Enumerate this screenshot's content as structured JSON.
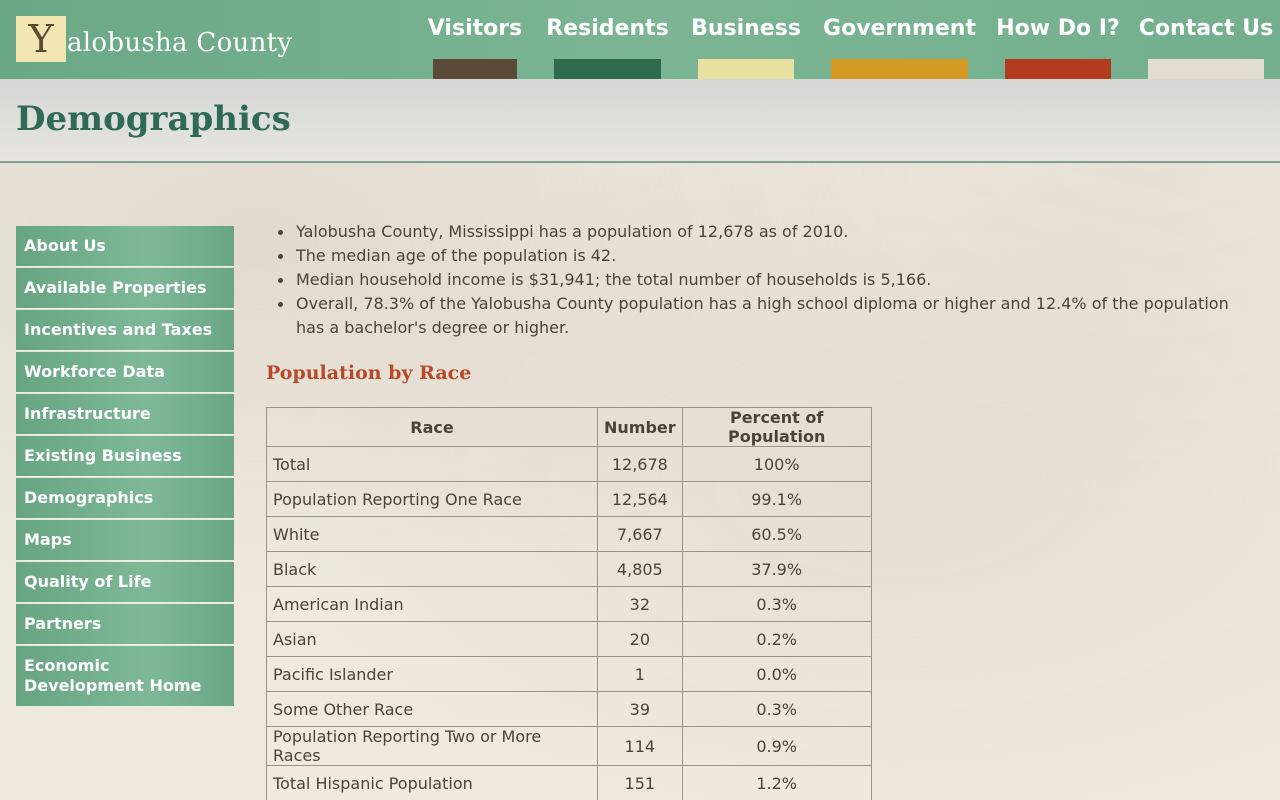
{
  "header": {
    "logo_letter": "Y",
    "logo_text": "alobusha County",
    "nav": [
      {
        "label": "Visitors",
        "color": "#5c4a38"
      },
      {
        "label": "Residents",
        "color": "#2e6a4e"
      },
      {
        "label": "Business",
        "color": "#e8e1a2"
      },
      {
        "label": "Government",
        "color": "#d49a24"
      },
      {
        "label": "How Do I?",
        "color": "#b33c1e"
      },
      {
        "label": "Contact Us",
        "color": "#e2dcd2"
      }
    ]
  },
  "page_title": "Demographics",
  "sidebar": {
    "items": [
      {
        "label": "About Us"
      },
      {
        "label": "Available Properties"
      },
      {
        "label": "Incentives and Taxes"
      },
      {
        "label": "Workforce Data"
      },
      {
        "label": "Infrastructure"
      },
      {
        "label": "Existing Business"
      },
      {
        "label": "Demographics"
      },
      {
        "label": "Maps"
      },
      {
        "label": "Quality of Life"
      },
      {
        "label": "Partners"
      },
      {
        "label": "Economic Development Home"
      }
    ]
  },
  "main": {
    "bullets": [
      "Yalobusha County, Mississippi has a population of 12,678 as of 2010.",
      "The median age of the population is 42.",
      "Median household income is $31,941; the total number of households is 5,166.",
      "Overall, 78.3% of the Yalobusha County population has a high school diploma or higher and 12.4% of the population has a bachelor's degree or higher."
    ],
    "section_heading": "Population by Race",
    "table": {
      "headers": [
        "Race",
        "Number",
        "Percent of Population"
      ],
      "rows": [
        [
          "Total",
          "12,678",
          "100%"
        ],
        [
          "Population Reporting One Race",
          "12,564",
          "99.1%"
        ],
        [
          "White",
          "7,667",
          "60.5%"
        ],
        [
          "Black",
          "4,805",
          "37.9%"
        ],
        [
          "American Indian",
          "32",
          "0.3%"
        ],
        [
          "Asian",
          "20",
          "0.2%"
        ],
        [
          "Pacific Islander",
          "1",
          "0.0%"
        ],
        [
          "Some Other Race",
          "39",
          "0.3%"
        ],
        [
          "Population Reporting Two or More Races",
          "114",
          "0.9%"
        ],
        [
          "Total Hispanic Population",
          "151",
          "1.2%"
        ]
      ]
    }
  }
}
